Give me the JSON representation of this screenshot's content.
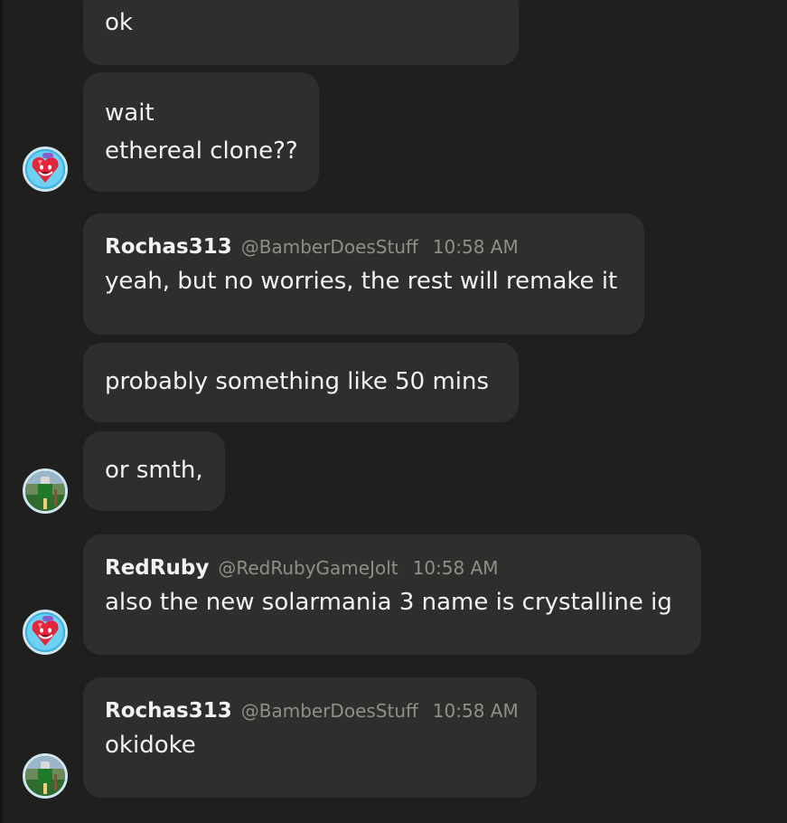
{
  "messages": [
    {
      "lines": [
        "ok"
      ]
    },
    {
      "lines": [
        "wait",
        "ethereal clone??"
      ]
    },
    {
      "author": "Rochas313",
      "handle": "@BamberDoesStuff",
      "time": "10:58 AM",
      "lines": [
        "yeah, but no worries, the rest will remake it"
      ]
    },
    {
      "lines": [
        "probably something like 50 mins"
      ]
    },
    {
      "lines": [
        "or smth,"
      ]
    },
    {
      "author": "RedRuby",
      "handle": "@RedRubyGameJolt",
      "time": "10:58 AM",
      "lines": [
        "also the new solarmania 3 name is crystalline ig"
      ]
    },
    {
      "author": "Rochas313",
      "handle": "@BamberDoesStuff",
      "time": "10:58 AM",
      "lines": [
        "okidoke"
      ]
    }
  ],
  "avatars": {
    "redruby": "ruby-heart-avatar-icon",
    "rochas313": "green-character-avatar-icon"
  },
  "colors": {
    "background": "#1f1f1d",
    "bubble": "#2e2e2c",
    "text": "#f2f2f2",
    "muted": "#8e8e8a"
  }
}
